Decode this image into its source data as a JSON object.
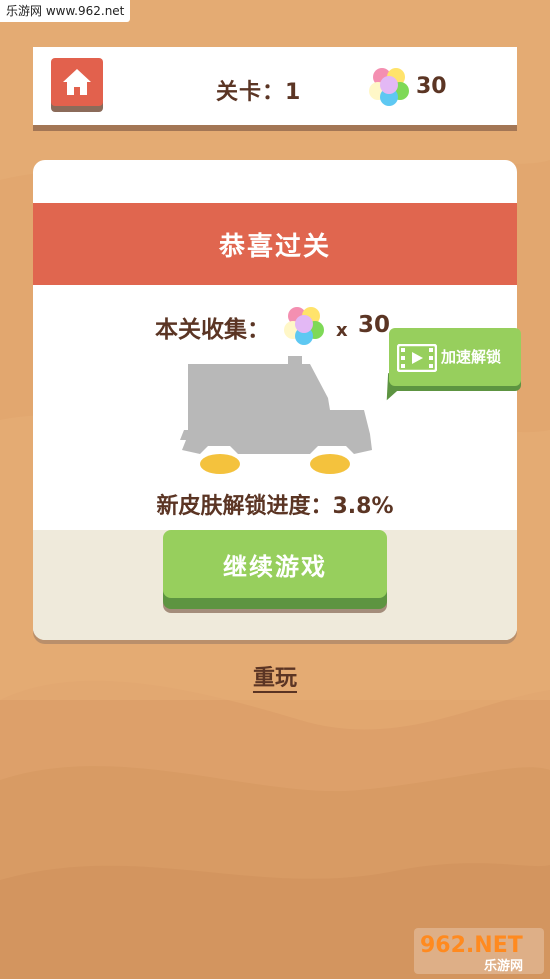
{
  "watermark": "乐游网 www.962.net",
  "header": {
    "level_label": "关卡：1",
    "gem_count": "30",
    "home_icon": "home-icon",
    "gem_icon": "gem-cluster-icon"
  },
  "dialog": {
    "title": "恭喜过关",
    "collect_label": "本关收集：",
    "collect_times": "x",
    "collect_count": "30",
    "unlock_label": "加速解锁",
    "unlock_icon": "video-play-icon",
    "progress_label": "新皮肤解锁进度：3.8%",
    "continue_label": "继续游戏"
  },
  "replay_label": "重玩",
  "logo": {
    "main": "962.NET",
    "sub": "乐游网"
  },
  "colors": {
    "banner": "#e0664f",
    "button_green": "#97cf5d",
    "text_brown": "#5b3524",
    "sand": "#e4ab73"
  }
}
